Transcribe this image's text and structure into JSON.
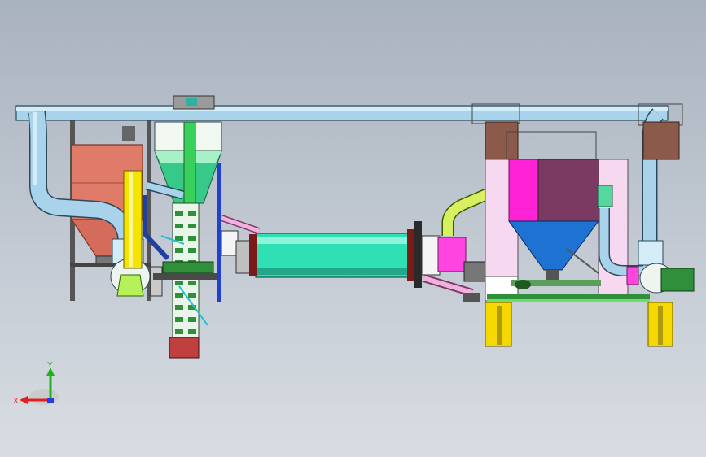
{
  "viewport": {
    "background_top": "#a9b2bf",
    "background_bottom": "#d9dde3"
  },
  "model": {
    "colors": {
      "duct": "#a9d3ea",
      "dust_hopper": "#e07b6a",
      "cyclone": "#36c98a",
      "elevator": "#38d05a",
      "yellow_duct": "#f5e400",
      "drum": "#2fe0b5",
      "baghouse_magenta": "#ff22d4",
      "baghouse_purple": "#7a3a62",
      "bag_hopper": "#1e72d2",
      "steel_frame": "#8b5a4a",
      "frame_panel": "#f6d8f0",
      "support_leg": "#f5d800",
      "chain_belt": "#2f8f3a"
    }
  },
  "triad": {
    "x_label": "X",
    "y_label": "Y",
    "x_color": "#e02020",
    "y_color": "#20b020",
    "z_color": "#2040e0"
  }
}
